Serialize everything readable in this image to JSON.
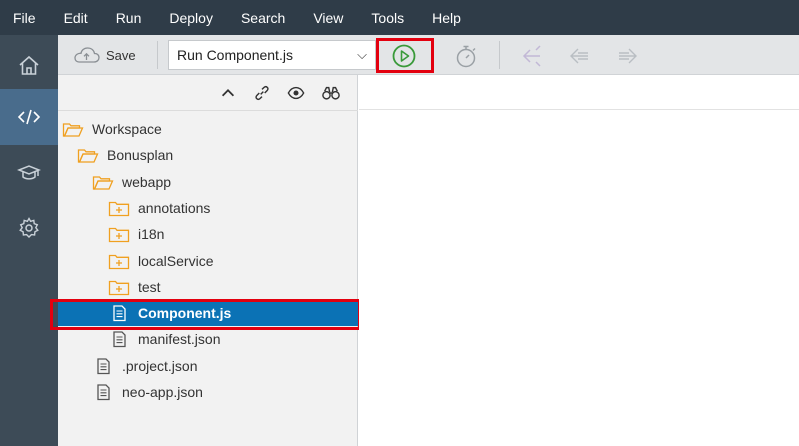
{
  "menu": [
    "File",
    "Edit",
    "Run",
    "Deploy",
    "Search",
    "View",
    "Tools",
    "Help"
  ],
  "sidebar": {
    "items": [
      {
        "name": "home-icon",
        "active": false
      },
      {
        "name": "code-icon",
        "active": true
      },
      {
        "name": "learning-cap-icon",
        "active": false
      },
      {
        "name": "gear-icon",
        "active": false
      }
    ]
  },
  "toolbar": {
    "save_label": "Save",
    "run_config": "Run Component.js",
    "run_icon": "play-icon",
    "timer_icon": "timer-icon",
    "nav_icons": [
      "debug-back-icon",
      "arrow-left-icon",
      "arrow-right-icon"
    ],
    "accent": "#3a9a3a"
  },
  "tree_tools": [
    "collapse-icon",
    "link-icon",
    "eye-icon",
    "binoculars-icon"
  ],
  "tree": [
    {
      "label": "Workspace",
      "type": "folder-open",
      "depth": 0
    },
    {
      "label": "Bonusplan",
      "type": "folder-open",
      "depth": 1
    },
    {
      "label": "webapp",
      "type": "folder-open",
      "depth": 2
    },
    {
      "label": "annotations",
      "type": "folder-closed",
      "depth": 3
    },
    {
      "label": "i18n",
      "type": "folder-closed",
      "depth": 3
    },
    {
      "label": "localService",
      "type": "folder-closed",
      "depth": 3
    },
    {
      "label": "test",
      "type": "folder-closed",
      "depth": 3
    },
    {
      "label": "Component.js",
      "type": "file",
      "depth": 3,
      "selected": true
    },
    {
      "label": "manifest.json",
      "type": "file",
      "depth": 3
    },
    {
      "label": ".project.json",
      "type": "file",
      "depth": 2
    },
    {
      "label": "neo-app.json",
      "type": "file",
      "depth": 2
    }
  ],
  "colors": {
    "menubar": "#2f3c48",
    "sidebar": "#3d4b57",
    "sidebar_active": "#496c8c",
    "selection": "#0b72b5",
    "folder": "#f0a020",
    "highlight": "#e3000f"
  }
}
